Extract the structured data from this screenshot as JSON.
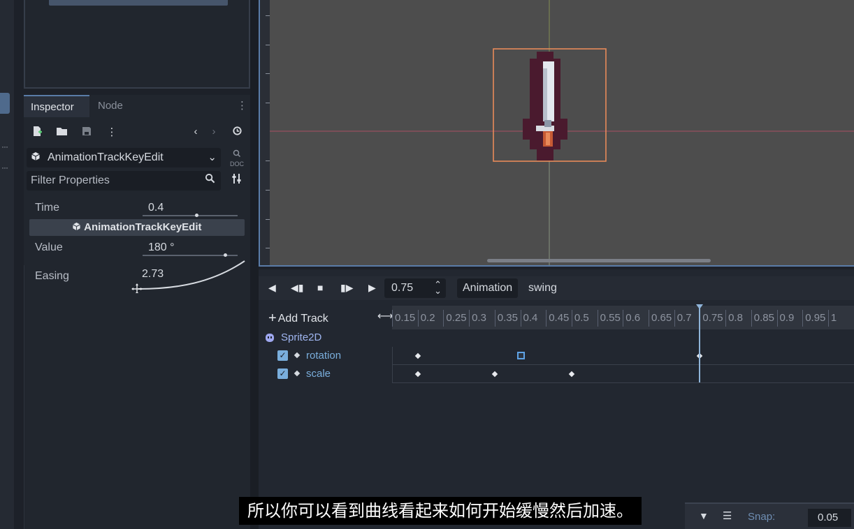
{
  "inspector": {
    "tabs": [
      "Inspector",
      "Node"
    ],
    "class_name": "AnimationTrackKeyEdit",
    "filter_placeholder": "Filter Properties",
    "doc_label": "DOC",
    "section_header": "AnimationTrackKeyEdit",
    "props": {
      "time": {
        "label": "Time",
        "value": "0.4",
        "slider_fraction": 0.55
      },
      "value": {
        "label": "Value",
        "value": "180 °",
        "slider_fraction": 0.85
      },
      "easing": {
        "label": "Easing",
        "value": "2.73"
      }
    }
  },
  "animation": {
    "time": "0.75",
    "menu_label": "Animation",
    "current_animation": "swing",
    "add_track": "Add Track",
    "ruler_labels": [
      "0.15",
      "0.2",
      "0.25",
      "0.3",
      "0.35",
      "0.4",
      "0.45",
      "0.5",
      "0.55",
      "0.6",
      "0.65",
      "0.7",
      "0.75",
      "0.8",
      "0.85",
      "0.9",
      "0.95",
      "1"
    ],
    "node": "Sprite2D",
    "tracks": [
      {
        "name": "rotation",
        "keys": [
          0.2,
          0.4,
          0.75
        ],
        "selected_key": 0.4
      },
      {
        "name": "scale",
        "keys": [
          0.2,
          0.35,
          0.5
        ]
      }
    ]
  },
  "bottom_bar": {
    "snap_label": "Snap:",
    "snap_value": "0.05"
  },
  "subtitle": "所以你可以看到曲线看起来如何开始缓慢然后加速。",
  "colors": {
    "accent": "#5a7ca8",
    "playhead": "#8fb4d9",
    "selection": "#e88a5a"
  }
}
